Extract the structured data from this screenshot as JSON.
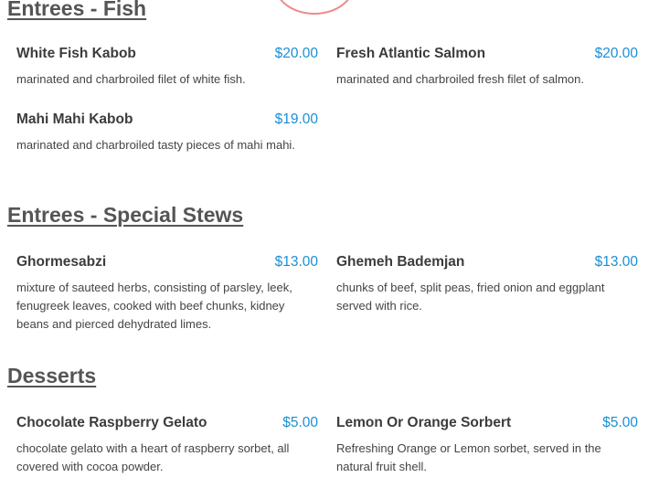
{
  "sections": [
    {
      "title": "Entrees - Fish",
      "items": [
        {
          "name": "White Fish Kabob",
          "price": "$20.00",
          "desc": "marinated and charbroiled filet of white fish."
        },
        {
          "name": "Fresh Atlantic Salmon",
          "price": "$20.00",
          "desc": "marinated and charbroiled fresh filet of salmon."
        },
        {
          "name": "Mahi Mahi Kabob",
          "price": "$19.00",
          "desc": "marinated and charbroiled tasty pieces of mahi mahi."
        }
      ]
    },
    {
      "title": "Entrees - Special Stews",
      "items": [
        {
          "name": "Ghormesabzi",
          "price": "$13.00",
          "desc": "mixture of sauteed herbs, consisting of parsley, leek, fenugreek leaves, cooked with beef chunks, kidney beans and pierced dehydrated limes."
        },
        {
          "name": "Ghemeh Bademjan",
          "price": "$13.00",
          "desc": "chunks of beef, split peas, fried onion and eggplant served with rice."
        }
      ]
    },
    {
      "title": "Desserts",
      "items": [
        {
          "name": "Chocolate Raspberry Gelato",
          "price": "$5.00",
          "desc": "chocolate gelato with a heart of raspberry sorbet, all covered with cocoa powder."
        },
        {
          "name": "Lemon Or Orange Sorbert",
          "price": "$5.00",
          "desc": "Refreshing Orange or Lemon sorbet, served in the natural fruit shell."
        }
      ]
    }
  ],
  "colors": {
    "price": "#1a8fd6",
    "logo_ring": "#f08a8a",
    "heading": "#555555"
  }
}
